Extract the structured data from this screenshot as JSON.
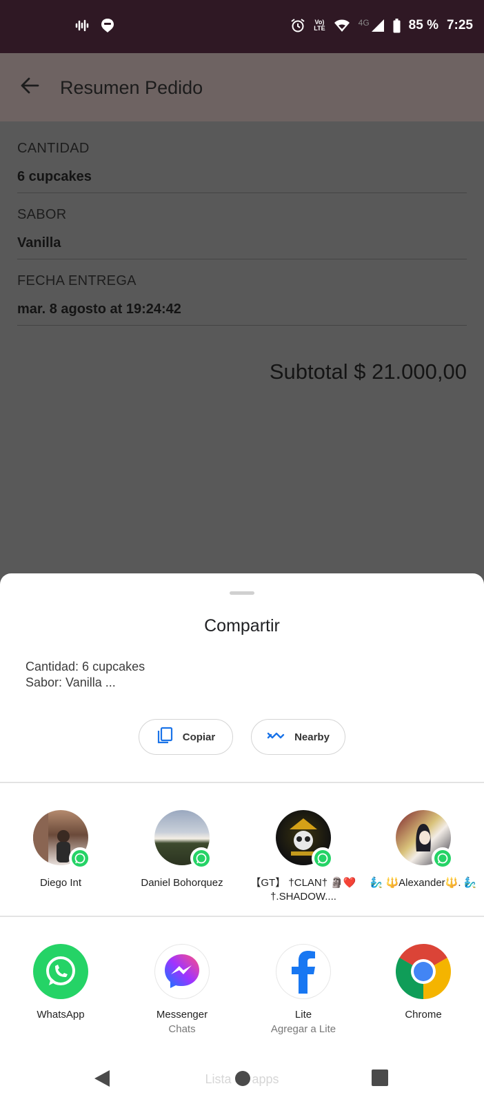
{
  "status_bar": {
    "left_icons": [
      "audio-waveform-icon",
      "map-pin-message-icon"
    ],
    "right_icons": [
      "alarm-icon",
      "volte-icon",
      "wifi-icon",
      "signal-4g-icon",
      "battery-icon"
    ],
    "volte_line1": "Vo)",
    "volte_line2": "LTE",
    "network": "4G",
    "battery": "85 %",
    "time": "7:25"
  },
  "app_bar": {
    "title": "Resumen Pedido",
    "back_icon": "arrow-back-icon"
  },
  "summary": {
    "fields": [
      {
        "label": "CANTIDAD",
        "value": "6 cupcakes"
      },
      {
        "label": "SABOR",
        "value": "Vanilla"
      },
      {
        "label": "FECHA ENTREGA",
        "value": "mar. 8 agosto at 19:24:42"
      }
    ],
    "subtotal": "Subtotal $ 21.000,00"
  },
  "share_sheet": {
    "title": "Compartir",
    "preview_line1": "Cantidad: 6 cupcakes",
    "preview_line2": "Sabor: Vanilla ...",
    "chips": [
      {
        "label": "Copiar",
        "icon": "copy-icon",
        "accent": "#1a73e8"
      },
      {
        "label": "Nearby",
        "icon": "nearby-share-icon",
        "accent": "#1a73e8"
      }
    ],
    "direct_targets": [
      {
        "name": "Diego Int",
        "badge": "whatsapp-icon"
      },
      {
        "name": "Daniel Bohorquez",
        "badge": "whatsapp-icon"
      },
      {
        "name": "【GT】 †CLAN† 🗿❤️†.SHADOW....",
        "badge": "whatsapp-icon"
      },
      {
        "name": "🧞‍♂️ 🔱Alexander🔱. 🧞‍♂️",
        "badge": "whatsapp-icon"
      }
    ],
    "apps": [
      {
        "name": "WhatsApp",
        "sub": "",
        "icon": "whatsapp-icon",
        "color": "#25d366"
      },
      {
        "name": "Messenger",
        "sub": "Chats",
        "icon": "messenger-icon",
        "color": "#a033ff"
      },
      {
        "name": "Lite",
        "sub": "Agregar a Lite",
        "icon": "facebook-icon",
        "color": "#1877f2"
      },
      {
        "name": "Chrome",
        "sub": "",
        "icon": "chrome-icon",
        "color": "#db4437"
      }
    ],
    "all_apps_label": "Lista de apps"
  },
  "nav_bar": {
    "buttons": [
      "back-triangle-icon",
      "home-circle-icon",
      "recents-square-icon"
    ]
  },
  "colors": {
    "status_bar": "#2f1824",
    "scrim": "#595959",
    "whatsapp_green": "#25d366",
    "accent_blue": "#1a73e8"
  }
}
